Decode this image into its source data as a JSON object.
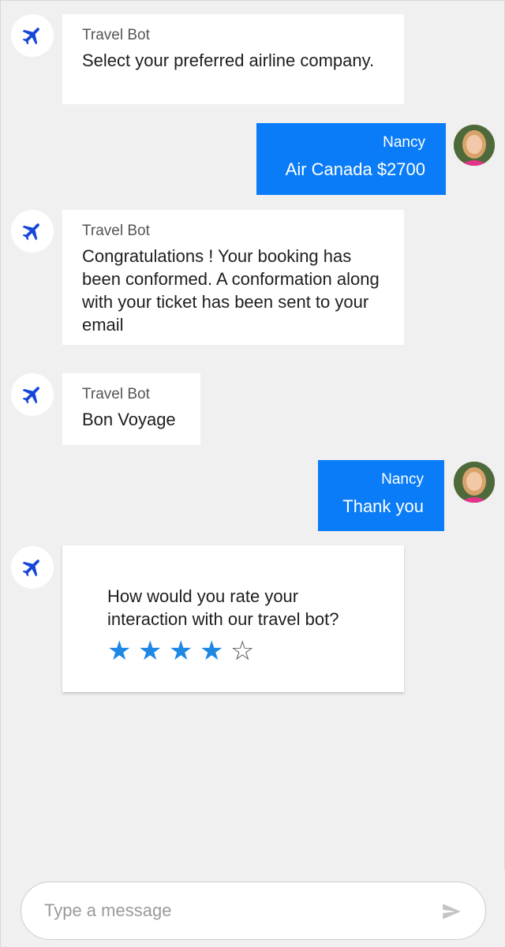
{
  "colors": {
    "background": "#f0f0f0",
    "bot_bubble": "#ffffff",
    "user_bubble": "#0a7cf7",
    "bot_icon": "#1546d8",
    "star_filled": "#1e88e5"
  },
  "bot": {
    "icon": "airplane-icon"
  },
  "messages": [
    {
      "from": "bot",
      "sender": "Travel Bot",
      "text": "Select your preferred airline company."
    },
    {
      "from": "user",
      "sender": "Nancy",
      "text": "Air Canada $2700"
    },
    {
      "from": "bot",
      "sender": "Travel Bot",
      "text": "Congratulations ! Your booking has been conformed. A conformation along with your ticket has been sent to your email"
    },
    {
      "from": "bot",
      "sender": "Travel Bot",
      "text": "Bon Voyage"
    },
    {
      "from": "user",
      "sender": "Nancy",
      "text": "Thank you"
    }
  ],
  "rating": {
    "question": "How would you rate your interaction with our travel bot?",
    "value": 4,
    "max": 5
  },
  "composer": {
    "placeholder": "Type a message",
    "send_icon": "send-icon"
  }
}
